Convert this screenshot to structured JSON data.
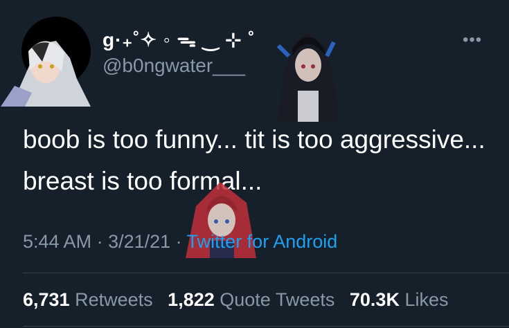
{
  "user": {
    "display_name": "g·₊˚✧ ◦ ᯓ ‿ ⊹ ˚",
    "handle": "@b0ngwater___"
  },
  "more_icon": "more-dots-icon",
  "tweet_text": "boob is too funny... tit is too aggressive... breast is too formal...",
  "meta": {
    "time": "5:44 AM",
    "separator": " · ",
    "date": "3/21/21",
    "source": "Twitter for Android"
  },
  "stats": {
    "retweets_count": "6,731",
    "retweets_label": "Retweets",
    "quote_count": "1,822",
    "quote_label": "Quote Tweets",
    "likes_count": "70.3K",
    "likes_label": "Likes"
  },
  "colors": {
    "background": "#15202b",
    "text": "#ffffff",
    "muted": "#8899a6",
    "link": "#1da1f2",
    "divider": "#38444d"
  }
}
